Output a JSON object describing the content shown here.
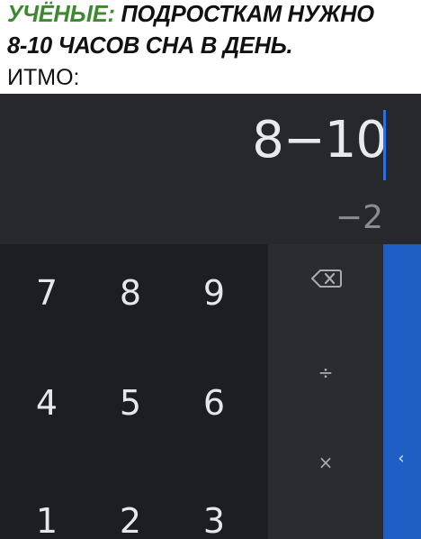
{
  "caption": {
    "line1_prefix": "УЧЁНЫЕ:",
    "line1_rest": " ПОДРОСТКАМ НУЖНО",
    "line2": "8-10 ЧАСОВ СНА В ДЕНЬ.",
    "line3": "ИТМО:"
  },
  "calculator": {
    "expression": "8−10",
    "result": "−2",
    "keys": [
      "7",
      "8",
      "9",
      "4",
      "5",
      "6",
      "1",
      "2",
      "3"
    ],
    "operators": {
      "divide": "÷",
      "multiply": "×"
    },
    "side_panel_toggle": "‹"
  },
  "icons": {
    "backspace": "backspace-icon",
    "chevron": "chevron-left-icon"
  },
  "colors": {
    "caption_accent": "#3d8a2e",
    "display_bg": "#27282c",
    "keypad_bg": "#1d1e21",
    "operators_bg": "#2b2c30",
    "side_panel": "#1f5fc4",
    "cursor": "#2f6de2"
  }
}
